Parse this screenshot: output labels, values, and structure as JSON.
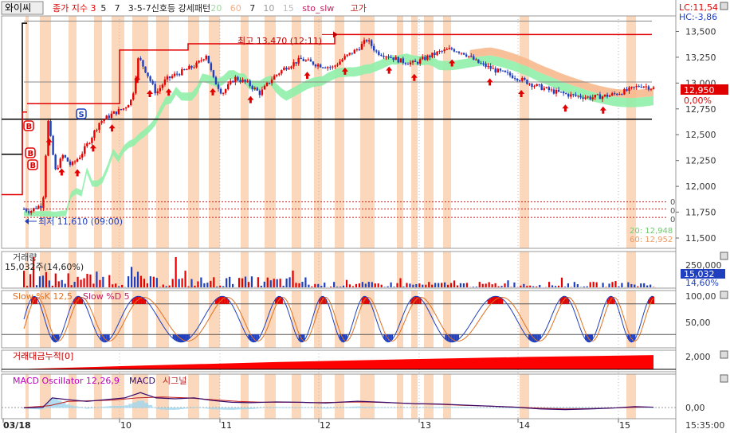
{
  "colors": {
    "bg": "#ffffff",
    "up": "#e60000",
    "down": "#1f3fbf",
    "band": "#f9c9a6",
    "band_soft": "#fde3cf",
    "ma_fill_green": "#90f0a8",
    "ma_fill_orange": "#f7b98e",
    "high_line": "#e00000",
    "level_line": "#000000",
    "stoch_k": "#1f3fbf",
    "stoch_d": "#e07020",
    "cum_fill": "#ff0000",
    "macd_line": "#3a0a6a",
    "signal_line": "#c02020",
    "osc_fill": "#9fd6ee",
    "axis_text": "#333333",
    "price_box": "#e00000",
    "vol_box": "#1f3fbf"
  },
  "chart_data": {
    "type": "candlestick",
    "symbol": "와이씨",
    "legend": [
      {
        "text": "종가 지수 3",
        "color": "#e00000"
      },
      {
        "text": "5",
        "color": "#222222"
      },
      {
        "text": "7",
        "color": "#222222"
      },
      {
        "text": "3-5-7신호등 강세패턴",
        "color": "#222222"
      },
      {
        "text": "20",
        "color": "#9fd6a0"
      },
      {
        "text": "60",
        "color": "#f4b08a"
      },
      {
        "text": "7",
        "color": "#222222"
      },
      {
        "text": "10",
        "color": "#999999"
      },
      {
        "text": "15",
        "color": "#bbbbbb"
      },
      {
        "text": "sto_slw",
        "color": "#c02060"
      },
      {
        "text": "고가",
        "color": "#c02020"
      }
    ],
    "lc_label": "LC:11,54",
    "hc_label": "HC:-3,86",
    "y_ticks": [
      "13,500",
      "13,250",
      "13,000",
      "12,750",
      "12,500",
      "12,250",
      "12,000",
      "11,750",
      "11,500"
    ],
    "ylim": [
      11400,
      13650
    ],
    "last_price": "12,950",
    "last_change": "0,00%",
    "ma_readout": [
      "20: 12,948",
      "60: 12,952"
    ],
    "high_label": "최고 13,470 (12:11)",
    "low_label": "최저 11,610 (09:00)",
    "zero_markers": [
      "0",
      "0",
      "0"
    ],
    "signal_markers": [
      {
        "letter": "B",
        "color": "#e00000"
      },
      {
        "letter": "B",
        "color": "#e00000"
      },
      {
        "letter": "B",
        "color": "#e00000"
      },
      {
        "letter": "S",
        "color": "#1f3fbf"
      }
    ],
    "x_labels": [
      "03/18",
      "10",
      "11",
      "12",
      "13",
      "14",
      "15"
    ],
    "time_label": "15:35:00",
    "volume": {
      "title": "거래량",
      "readout": "15,032주(14,60%)",
      "y_ticks": [
        "250,000"
      ],
      "last_value": "15,032",
      "last_pct": "14,60%"
    },
    "stochastic": {
      "title_k": "Slow %K 12,5",
      "title_d": "Slow %D 5",
      "y_ticks": [
        "100,00",
        "50,00"
      ]
    },
    "cumulative": {
      "title": "거래대금누적[0]",
      "y_ticks": [
        "2,000"
      ]
    },
    "macd": {
      "title_osc": "MACD Oscillator 12,26,9",
      "title_macd": "MACD",
      "title_signal": "시그널",
      "y_ticks": [
        "0,00"
      ]
    },
    "price_path": [
      [
        0.0,
        11780
      ],
      [
        0.01,
        11760
      ],
      [
        0.02,
        11800
      ],
      [
        0.03,
        11820
      ],
      [
        0.038,
        12650
      ],
      [
        0.05,
        12150
      ],
      [
        0.062,
        12300
      ],
      [
        0.075,
        12200
      ],
      [
        0.09,
        12300
      ],
      [
        0.105,
        12450
      ],
      [
        0.12,
        12620
      ],
      [
        0.14,
        12700
      ],
      [
        0.16,
        12760
      ],
      [
        0.172,
        12850
      ],
      [
        0.182,
        13250
      ],
      [
        0.195,
        13100
      ],
      [
        0.21,
        12900
      ],
      [
        0.225,
        13030
      ],
      [
        0.24,
        13080
      ],
      [
        0.255,
        13120
      ],
      [
        0.275,
        13180
      ],
      [
        0.29,
        13280
      ],
      [
        0.3,
        13050
      ],
      [
        0.315,
        12900
      ],
      [
        0.335,
        13050
      ],
      [
        0.355,
        13000
      ],
      [
        0.375,
        12900
      ],
      [
        0.395,
        13050
      ],
      [
        0.415,
        13150
      ],
      [
        0.44,
        13230
      ],
      [
        0.465,
        13180
      ],
      [
        0.49,
        13150
      ],
      [
        0.51,
        13250
      ],
      [
        0.53,
        13330
      ],
      [
        0.545,
        13420
      ],
      [
        0.56,
        13300
      ],
      [
        0.58,
        13260
      ],
      [
        0.6,
        13210
      ],
      [
        0.62,
        13190
      ],
      [
        0.64,
        13250
      ],
      [
        0.66,
        13300
      ],
      [
        0.68,
        13330
      ],
      [
        0.7,
        13290
      ],
      [
        0.72,
        13200
      ],
      [
        0.75,
        13120
      ],
      [
        0.78,
        13060
      ],
      [
        0.81,
        12980
      ],
      [
        0.84,
        12920
      ],
      [
        0.87,
        12880
      ],
      [
        0.9,
        12860
      ],
      [
        0.93,
        12880
      ],
      [
        0.96,
        12930
      ],
      [
        0.98,
        12980
      ],
      [
        1.0,
        12950
      ]
    ],
    "macd_path": [
      [
        0.0,
        -0.02
      ],
      [
        0.03,
        0.01
      ],
      [
        0.045,
        0.55
      ],
      [
        0.07,
        0.45
      ],
      [
        0.1,
        0.35
      ],
      [
        0.13,
        0.45
      ],
      [
        0.16,
        0.55
      ],
      [
        0.185,
        0.85
      ],
      [
        0.21,
        0.55
      ],
      [
        0.24,
        0.5
      ],
      [
        0.27,
        0.55
      ],
      [
        0.3,
        0.4
      ],
      [
        0.33,
        0.3
      ],
      [
        0.36,
        0.28
      ],
      [
        0.4,
        0.32
      ],
      [
        0.44,
        0.3
      ],
      [
        0.48,
        0.26
      ],
      [
        0.53,
        0.36
      ],
      [
        0.57,
        0.3
      ],
      [
        0.62,
        0.22
      ],
      [
        0.66,
        0.2
      ],
      [
        0.7,
        0.14
      ],
      [
        0.74,
        0.08
      ],
      [
        0.78,
        0.02
      ],
      [
        0.82,
        -0.08
      ],
      [
        0.86,
        -0.12
      ],
      [
        0.9,
        -0.08
      ],
      [
        0.94,
        -0.02
      ],
      [
        0.97,
        0.05
      ],
      [
        1.0,
        0.02
      ]
    ],
    "signal_path": [
      [
        0.0,
        0.0
      ],
      [
        0.04,
        0.1
      ],
      [
        0.07,
        0.35
      ],
      [
        0.1,
        0.38
      ],
      [
        0.14,
        0.42
      ],
      [
        0.18,
        0.55
      ],
      [
        0.22,
        0.6
      ],
      [
        0.26,
        0.55
      ],
      [
        0.3,
        0.45
      ],
      [
        0.34,
        0.35
      ],
      [
        0.38,
        0.3
      ],
      [
        0.42,
        0.3
      ],
      [
        0.46,
        0.28
      ],
      [
        0.5,
        0.3
      ],
      [
        0.54,
        0.32
      ],
      [
        0.58,
        0.28
      ],
      [
        0.62,
        0.22
      ],
      [
        0.66,
        0.18
      ],
      [
        0.7,
        0.12
      ],
      [
        0.74,
        0.08
      ],
      [
        0.78,
        0.03
      ],
      [
        0.82,
        -0.04
      ],
      [
        0.86,
        -0.08
      ],
      [
        0.9,
        -0.06
      ],
      [
        0.94,
        -0.02
      ],
      [
        0.98,
        0.02
      ],
      [
        1.0,
        0.02
      ]
    ],
    "cum_path": [
      [
        0.0,
        0.02
      ],
      [
        0.03,
        0.06
      ],
      [
        0.2,
        0.26
      ],
      [
        0.4,
        0.48
      ],
      [
        0.6,
        0.66
      ],
      [
        0.8,
        0.82
      ],
      [
        1.0,
        0.94
      ]
    ]
  }
}
